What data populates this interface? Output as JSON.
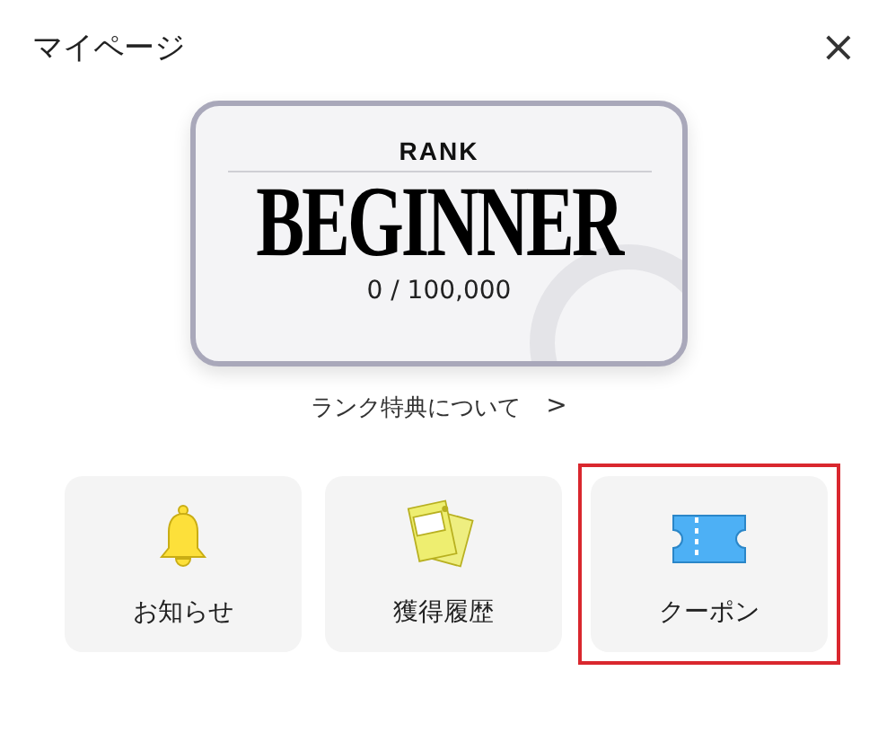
{
  "header": {
    "title": "マイページ",
    "close": "×"
  },
  "rank_card": {
    "label": "RANK",
    "rank": "BEGINNER",
    "points": "0 / 100,000"
  },
  "rank_link": {
    "label": "ランク特典について",
    "chevron": ">"
  },
  "tiles": [
    {
      "kind": "bell",
      "label": "お知らせ",
      "selected": false
    },
    {
      "kind": "cards",
      "label": "獲得履歴",
      "selected": false
    },
    {
      "kind": "ticket",
      "label": "クーポン",
      "selected": true
    }
  ]
}
